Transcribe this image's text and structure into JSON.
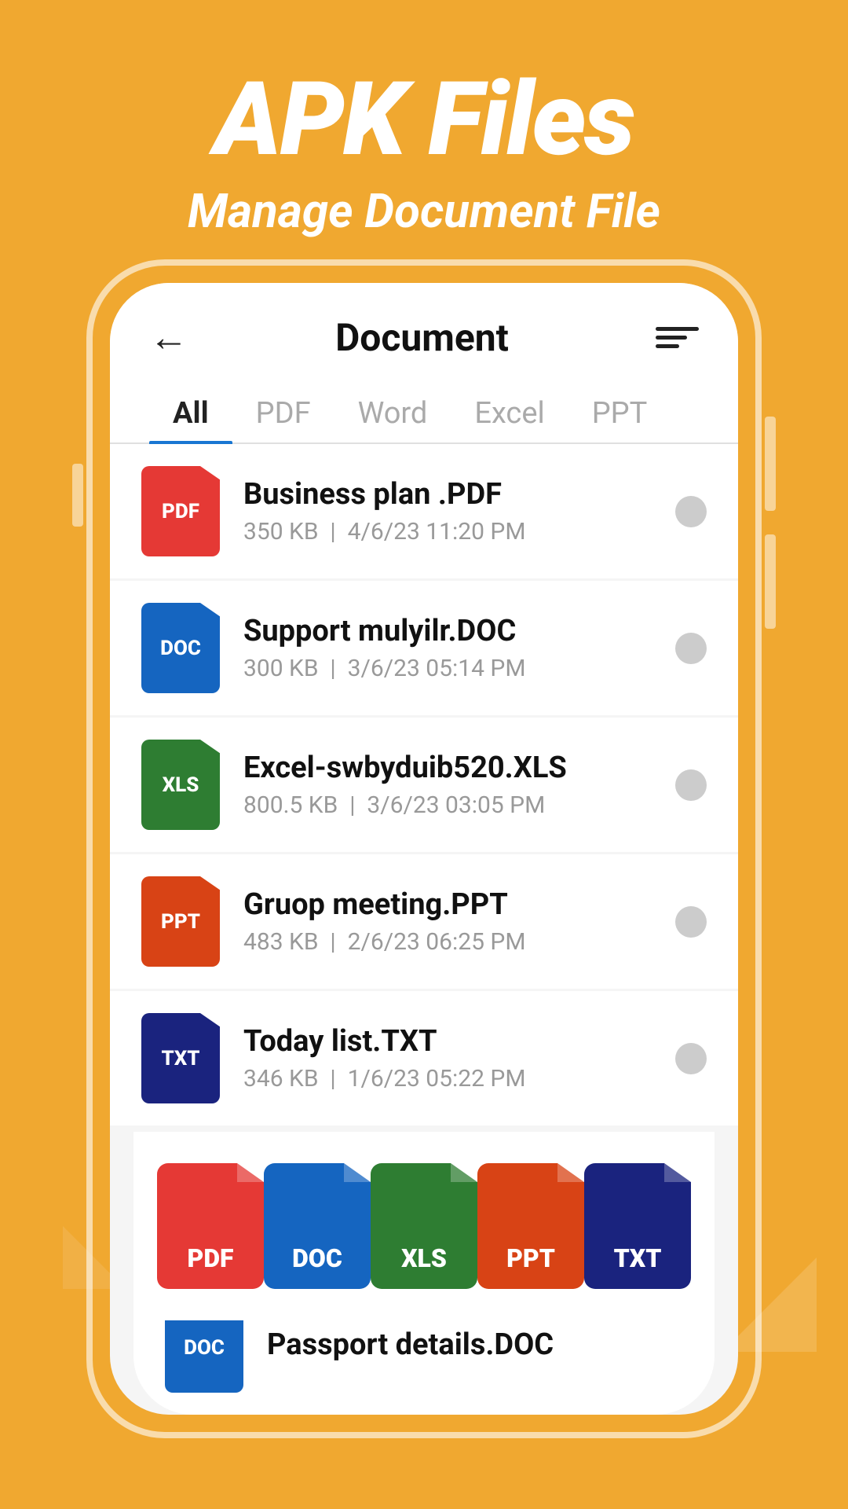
{
  "header": {
    "title": "APK Files",
    "subtitle": "Manage Document File"
  },
  "app": {
    "screen_title": "Document",
    "back_label": "←",
    "tabs": [
      {
        "id": "all",
        "label": "All",
        "active": true
      },
      {
        "id": "pdf",
        "label": "PDF",
        "active": false
      },
      {
        "id": "word",
        "label": "Word",
        "active": false
      },
      {
        "id": "excel",
        "label": "Excel",
        "active": false
      },
      {
        "id": "ppt",
        "label": "PPT",
        "active": false
      }
    ],
    "files": [
      {
        "name": "Business plan .PDF",
        "size": "350 KB",
        "date": "4/6/23 11:20 PM",
        "type": "pdf",
        "label": "PDF"
      },
      {
        "name": "Support mulyilr.DOC",
        "size": "300 KB",
        "date": "3/6/23 05:14 PM",
        "type": "doc",
        "label": "DOC"
      },
      {
        "name": "Excel-swbyduib520.XLS",
        "size": "800.5 KB",
        "date": "3/6/23 03:05 PM",
        "type": "xls",
        "label": "XLS"
      },
      {
        "name": "Gruop meeting.PPT",
        "size": "483 KB",
        "date": "2/6/23 06:25 PM",
        "type": "ppt",
        "label": "PPT"
      },
      {
        "name": "Today list.TXT",
        "size": "346 KB",
        "date": "1/6/23 05:22 PM",
        "type": "txt",
        "label": "TXT"
      }
    ],
    "bottom_types": [
      {
        "type": "pdf",
        "label": "PDF"
      },
      {
        "type": "doc",
        "label": "DOC"
      },
      {
        "type": "xls",
        "label": "XLS"
      },
      {
        "type": "ppt",
        "label": "PPT"
      },
      {
        "type": "txt",
        "label": "TXT"
      }
    ],
    "last_file": {
      "name": "Passport details.DOC",
      "type": "doc",
      "label": "DOC"
    }
  }
}
